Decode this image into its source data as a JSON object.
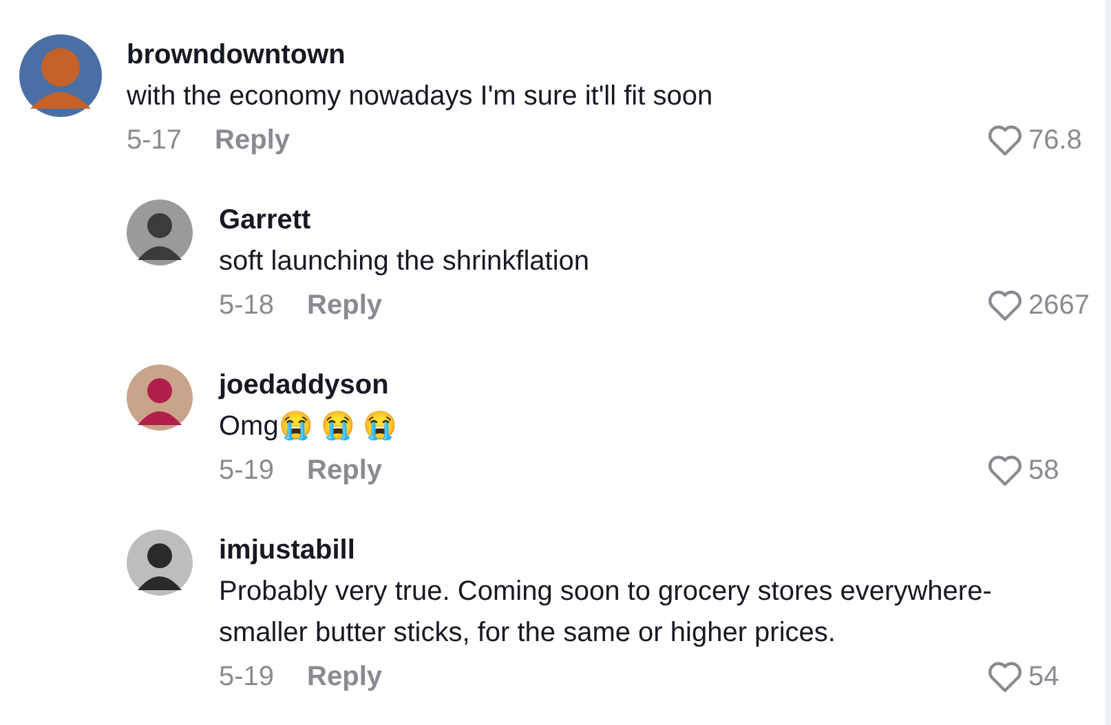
{
  "comments": [
    {
      "author": "browndowntown",
      "text": "with the economy nowadays I'm sure it'll fit soon",
      "date": "5-17",
      "reply_label": "Reply",
      "likes": "76.8",
      "replies": [
        {
          "author": "Garrett",
          "text": "soft launching the shrinkflation",
          "date": "5-18",
          "reply_label": "Reply",
          "likes": "2667"
        },
        {
          "author": "joedaddyson",
          "text": "Omg😭 😭 😭",
          "date": "5-19",
          "reply_label": "Reply",
          "likes": "58"
        },
        {
          "author": "imjustabill",
          "text": "Probably very true. Coming soon to grocery stores everywhere- smaller butter sticks, for the same or higher prices.",
          "date": "5-19",
          "reply_label": "Reply",
          "likes": "54"
        }
      ]
    }
  ]
}
